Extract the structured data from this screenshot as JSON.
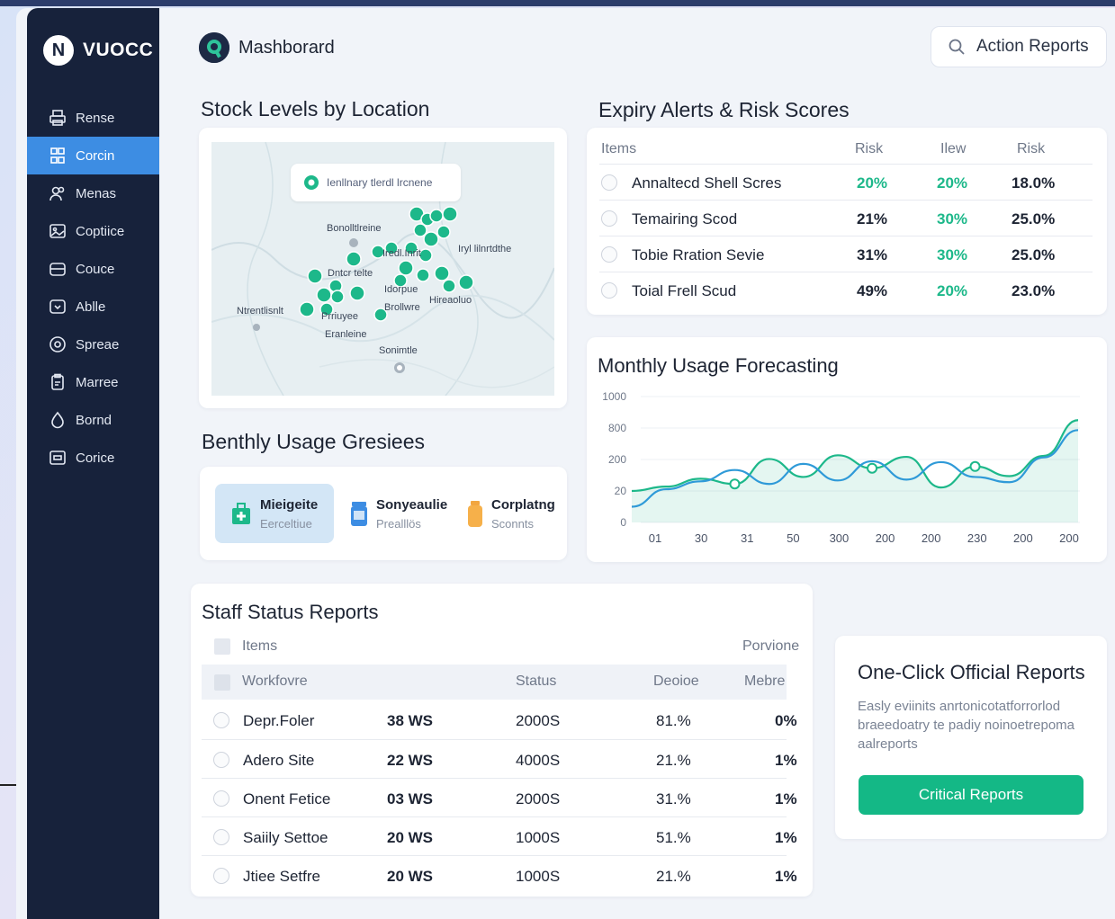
{
  "app": {
    "name": "VUOCC",
    "logo_letter": "N"
  },
  "sidebar": {
    "items": [
      {
        "label": "Rense",
        "icon": "printer-icon"
      },
      {
        "label": "Corcin",
        "icon": "network-icon",
        "active": true
      },
      {
        "label": "Menas",
        "icon": "users-icon"
      },
      {
        "label": "Coptiice",
        "icon": "photo-icon"
      },
      {
        "label": "Couce",
        "icon": "folder-icon"
      },
      {
        "label": "Ablle",
        "icon": "box-icon"
      },
      {
        "label": "Spreae",
        "icon": "circle-badge-icon"
      },
      {
        "label": "Marree",
        "icon": "clipboard-icon"
      },
      {
        "label": "Bornd",
        "icon": "drop-icon"
      },
      {
        "label": "Corice",
        "icon": "card-icon"
      }
    ]
  },
  "header": {
    "title": "Mashborard",
    "logo_letter": "Q",
    "action_label": "Action Reports",
    "action_icon": "search-icon"
  },
  "stock": {
    "title": "Stock Levels by Location",
    "map_tag": "Ienllnary tlerdl lrcnene",
    "labels": [
      "Bonolltlreine",
      "Iredl.Inrit",
      "Iryl lilnrtdthe",
      "Dntcr telte",
      "Idorpue",
      "Hireaoluo",
      "Brollwre",
      "Ntrentlisnlt",
      "Prriuyee",
      "Eranleine",
      "Sonimtle"
    ]
  },
  "expiry": {
    "title": "Expiry Alerts & Risk Scores",
    "headers": [
      "Items",
      "Risk",
      "Ilew",
      "Risk"
    ],
    "rows": [
      {
        "item": "Annaltecd Shell Scres",
        "risk": "20%",
        "new": "20%",
        "score": "18.0%",
        "risk_green": true,
        "new_green": true
      },
      {
        "item": "Temairing Scod",
        "risk": "21%",
        "new": "30%",
        "score": "25.0%",
        "risk_green": false,
        "new_green": true
      },
      {
        "item": "Tobie Rration Sevie",
        "risk": "31%",
        "new": "30%",
        "score": "25.0%",
        "risk_green": false,
        "new_green": true
      },
      {
        "item": "Toial Frell Scud",
        "risk": "49%",
        "new": "20%",
        "score": "23.0%",
        "risk_green": false,
        "new_green": true
      }
    ]
  },
  "usage": {
    "title": "Benthly Usage Gresiees",
    "tiles": [
      {
        "label": "Mieigeite",
        "sub": "Eerceltiue",
        "icon": "medkit-icon",
        "active": true
      },
      {
        "label": "Sonyeaulie",
        "sub": "Prealllös",
        "icon": "vial-icon",
        "active": false
      },
      {
        "label": "Corplatng",
        "sub": "Sconnts",
        "icon": "bottle-icon",
        "active": false
      }
    ]
  },
  "forecast": {
    "title": "Monthly Usage Forecasting"
  },
  "chart_data": {
    "type": "line",
    "title": "Monthly Usage Forecasting",
    "y_tick_labels": [
      "1000",
      "800",
      "200",
      "20",
      "0"
    ],
    "x_tick_labels": [
      "01",
      "30",
      "31",
      "50",
      "300",
      "200",
      "200",
      "230",
      "200",
      "200"
    ],
    "series": [
      {
        "values": [
          20,
          45,
          90,
          60,
          210,
          100,
          280,
          150,
          250,
          40,
          160,
          105,
          270,
          850
        ],
        "color": "#1db88a"
      },
      {
        "values": [
          10,
          30,
          75,
          140,
          60,
          175,
          80,
          190,
          85,
          185,
          100,
          70,
          240,
          760
        ],
        "color": "#2f9ad8"
      }
    ]
  },
  "staff": {
    "title": "Staff Status Reports",
    "top_headers": [
      "Items",
      "Porvione"
    ],
    "headers": [
      "Workfovre",
      "Status",
      "Deoioe",
      "Mebre"
    ],
    "rows": [
      {
        "name": "Depr.Foler",
        "ws": "38 WS",
        "status": "2000S",
        "device": "81.%",
        "more": "0%"
      },
      {
        "name": "Adero Site",
        "ws": "22 WS",
        "status": "4000S",
        "device": "21.%",
        "more": "1%"
      },
      {
        "name": "Onent Fetice",
        "ws": "03 WS",
        "status": "2000S",
        "device": "31.%",
        "more": "1%"
      },
      {
        "name": "Saiily Settoe",
        "ws": "20 WS",
        "status": "1000S",
        "device": "51.%",
        "more": "1%"
      },
      {
        "name": "Jtiee Setfre",
        "ws": "20 WS",
        "status": "1000S",
        "device": "21.%",
        "more": "1%"
      }
    ]
  },
  "reports": {
    "title": "One-Click Official Reports",
    "description": "Easly eviinits anrtonicotatforrorlod braeedoatry te padiy noinoetrepoma aalreports",
    "button": "Critical Reports"
  },
  "colors": {
    "accent": "#1db88a",
    "brand": "#17223b",
    "active_nav": "#3d8de3"
  }
}
